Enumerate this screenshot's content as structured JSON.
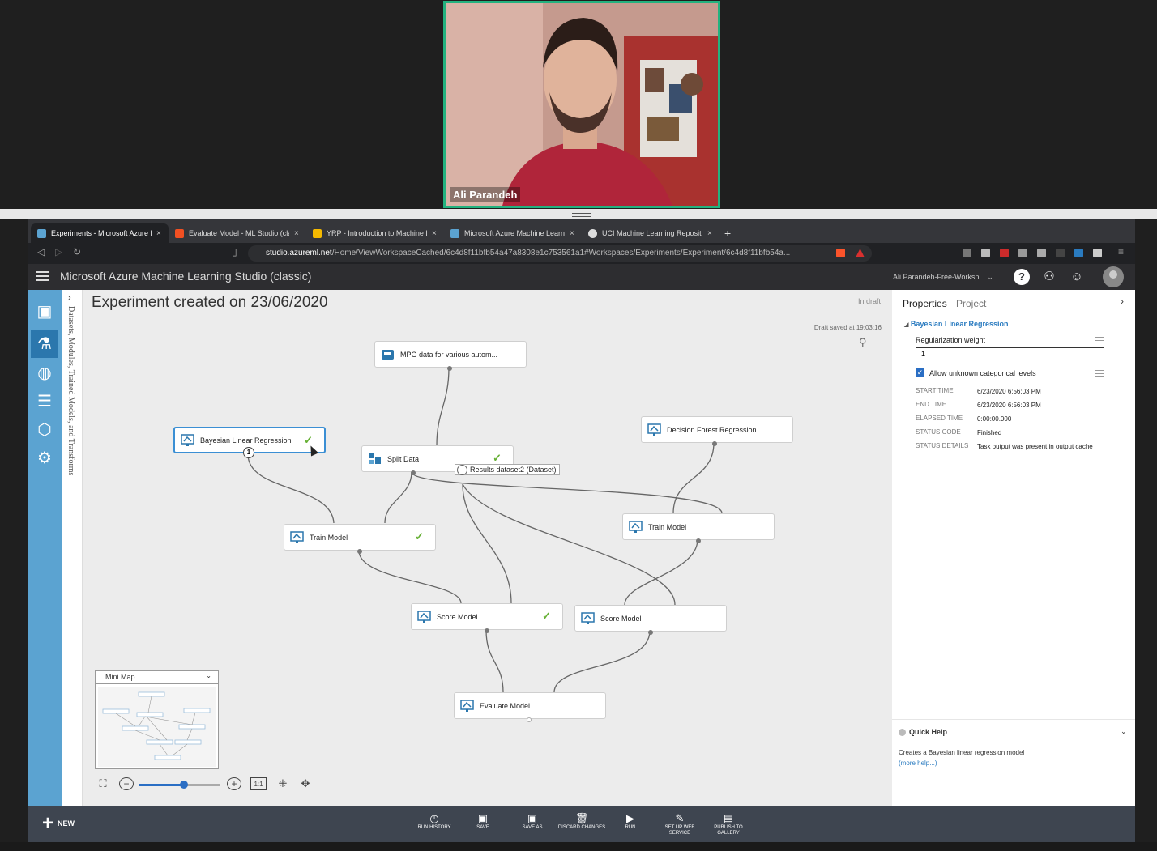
{
  "video": {
    "participant_name": "Ali Parandeh"
  },
  "browser": {
    "tabs": [
      {
        "title": "Experiments - Microsoft Azure M",
        "favicon_color": "#5ba3d1",
        "active": true
      },
      {
        "title": "Evaluate Model - ML Studio (cla",
        "favicon_color": "#f25022",
        "active": false
      },
      {
        "title": "YRP - Introduction to Machine L",
        "favicon_color": "#f5b900",
        "active": false
      },
      {
        "title": "Microsoft Azure Machine Learnin",
        "favicon_color": "#5ba3d1",
        "active": false
      },
      {
        "title": "UCI Machine Learning Repository",
        "favicon_color": "#dddddd",
        "active": false
      }
    ],
    "new_tab": "+",
    "close_glyph": "×",
    "url_host": "studio.azureml.net",
    "url_path": "/Home/ViewWorkspaceCached/6c4d8f11bfb54a47a8308e1c753561a1#Workspaces/Experiments/Experiment/6c4d8f11bfb54a..."
  },
  "header": {
    "app_title": "Microsoft Azure Machine Learning Studio (classic)",
    "workspace": "Ali Parandeh-Free-Worksp...",
    "workspace_caret": "⌄",
    "help_glyph": "?",
    "community_glyph": "⚇",
    "feedback_glyph": "☺"
  },
  "leftnav": {
    "items": [
      {
        "name": "projects",
        "glyph": "▣"
      },
      {
        "name": "experiments",
        "glyph": "⚗"
      },
      {
        "name": "web-services",
        "glyph": "◍"
      },
      {
        "name": "datasets",
        "glyph": "☰"
      },
      {
        "name": "trained-models",
        "glyph": "⬡"
      },
      {
        "name": "settings",
        "glyph": "⚙"
      }
    ]
  },
  "palette": {
    "label": "Datasets, Modules, Trained Models, and Transforms",
    "toggle": "›"
  },
  "canvas": {
    "title": "Experiment created on 23/06/2020",
    "status": "In draft",
    "draft_saved": "Draft saved at 19:03:16",
    "tooltip": "Results dataset2 (Dataset)",
    "badge": "1",
    "checkmark": "✓",
    "modules": {
      "mpg": "MPG data for various autom...",
      "bayesian": "Bayesian Linear Regression",
      "split": "Split Data",
      "decision_forest": "Decision Forest Regression",
      "train1": "Train Model",
      "train2": "Train Model",
      "score1": "Score Model",
      "score2": "Score Model",
      "evaluate": "Evaluate Model"
    },
    "minimap_title": "Mini Map",
    "minimap_caret": "⌄",
    "zoom_level": 0.55,
    "zoom_reset_label": "1:1"
  },
  "properties": {
    "tab_properties": "Properties",
    "tab_project": "Project",
    "collapse_glyph": "›",
    "module_heading": "Bayesian Linear Regression",
    "heading_caret": "◢",
    "reg_label": "Regularization weight",
    "reg_value": "1",
    "allow_label": "Allow unknown categorical levels",
    "allow_checked": true,
    "allow_glyph": "✓",
    "stats": {
      "start_time_k": "START TIME",
      "start_time_v": "6/23/2020 6:56:03 PM",
      "end_time_k": "END TIME",
      "end_time_v": "6/23/2020 6:56:03 PM",
      "elapsed_k": "ELAPSED TIME",
      "elapsed_v": "0:00:00.000",
      "status_code_k": "STATUS CODE",
      "status_code_v": "Finished",
      "status_details_k": "STATUS DETAILS",
      "status_details_v": "Task output was present in output cache"
    }
  },
  "quickhelp": {
    "title": "Quick Help",
    "toggle": "⌄",
    "text": "Creates a Bayesian linear regression model",
    "link": "(more help...)"
  },
  "commands": {
    "new": "NEW",
    "new_plus": "+",
    "run_history": "RUN HISTORY",
    "save": "SAVE",
    "save_as": "SAVE AS",
    "discard": "DISCARD CHANGES",
    "run": "RUN",
    "web_service": "SET UP WEB SERVICE",
    "publish": "PUBLISH TO GALLERY"
  },
  "colors": {
    "accent": "#5ba3d1",
    "accent_dark": "#2b77ad",
    "success": "#66b034",
    "link": "#2a7bc0",
    "video_border": "#23b27f"
  }
}
